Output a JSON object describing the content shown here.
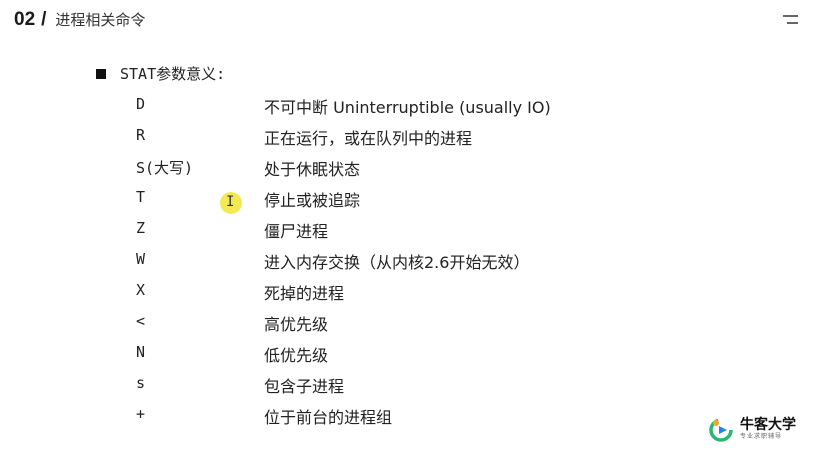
{
  "header": {
    "section_number": "02",
    "slash": "/",
    "section_title": "进程相关命令"
  },
  "menu": {
    "icon": "menu-icon"
  },
  "content": {
    "heading": "STAT参数意义:",
    "rows": [
      {
        "code": "D",
        "desc": "不可中断 Uninterruptible (usually IO)"
      },
      {
        "code": "R",
        "desc": "正在运行，或在队列中的进程"
      },
      {
        "code": "S(大写)",
        "desc": "处于休眠状态"
      },
      {
        "code": "T",
        "desc": "停止或被追踪"
      },
      {
        "code": "Z",
        "desc": "僵尸进程"
      },
      {
        "code": "W",
        "desc": "进入内存交换（从内核2.6开始无效）"
      },
      {
        "code": "X",
        "desc": "死掉的进程"
      },
      {
        "code": "<",
        "desc": "高优先级"
      },
      {
        "code": "N",
        "desc": "低优先级"
      },
      {
        "code": "s",
        "desc": "包含子进程"
      },
      {
        "code": "+",
        "desc": "位于前台的进程组"
      }
    ]
  },
  "cursor": {
    "glyph": "I",
    "highlight_color": "#f3e84a"
  },
  "logo": {
    "name": "牛客大学",
    "tagline": "专业求职辅导",
    "colors": {
      "green": "#2bb673",
      "orange": "#f5a623",
      "blue": "#1e88e5"
    }
  }
}
